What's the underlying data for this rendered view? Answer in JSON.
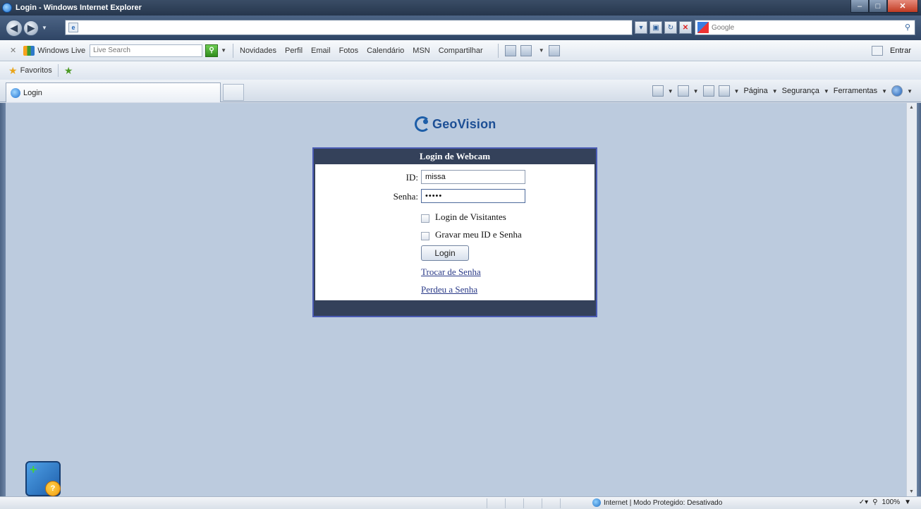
{
  "window": {
    "title": "Login - Windows Internet Explorer"
  },
  "search": {
    "placeholder": "Google"
  },
  "live_toolbar": {
    "brand": "Windows Live",
    "search_placeholder": "Live Search",
    "links": [
      "Novidades",
      "Perfil",
      "Email",
      "Fotos",
      "Calendário",
      "MSN",
      "Compartilhar"
    ],
    "signin": "Entrar"
  },
  "favorites": {
    "label": "Favoritos"
  },
  "tab": {
    "label": "Login"
  },
  "command_bar": {
    "page": "Página",
    "security": "Segurança",
    "tools": "Ferramentas"
  },
  "page": {
    "logo_text": "GeoVision",
    "login_title": "Login de Webcam",
    "id_label": "ID:",
    "id_value": "missa",
    "password_label": "Senha:",
    "password_value": "•••••",
    "guest_login_label": "Login de Visitantes",
    "remember_label": "Gravar meu ID e Senha",
    "login_button": "Login",
    "change_password_link": "Trocar de Senha",
    "forgot_password_link": "Perdeu a Senha"
  },
  "status": {
    "zone": "Internet | Modo Protegido: Desativado",
    "zoom": "100%"
  },
  "icons": [
    "ie-icon",
    "back-icon",
    "forward-icon",
    "refresh-icon",
    "stop-icon",
    "search-icon",
    "favorites-star-icon",
    "add-favorite-icon",
    "home-icon",
    "feeds-icon",
    "mail-icon",
    "print-icon",
    "help-icon",
    "globe-icon",
    "zoom-icon",
    "gadget-icon"
  ]
}
